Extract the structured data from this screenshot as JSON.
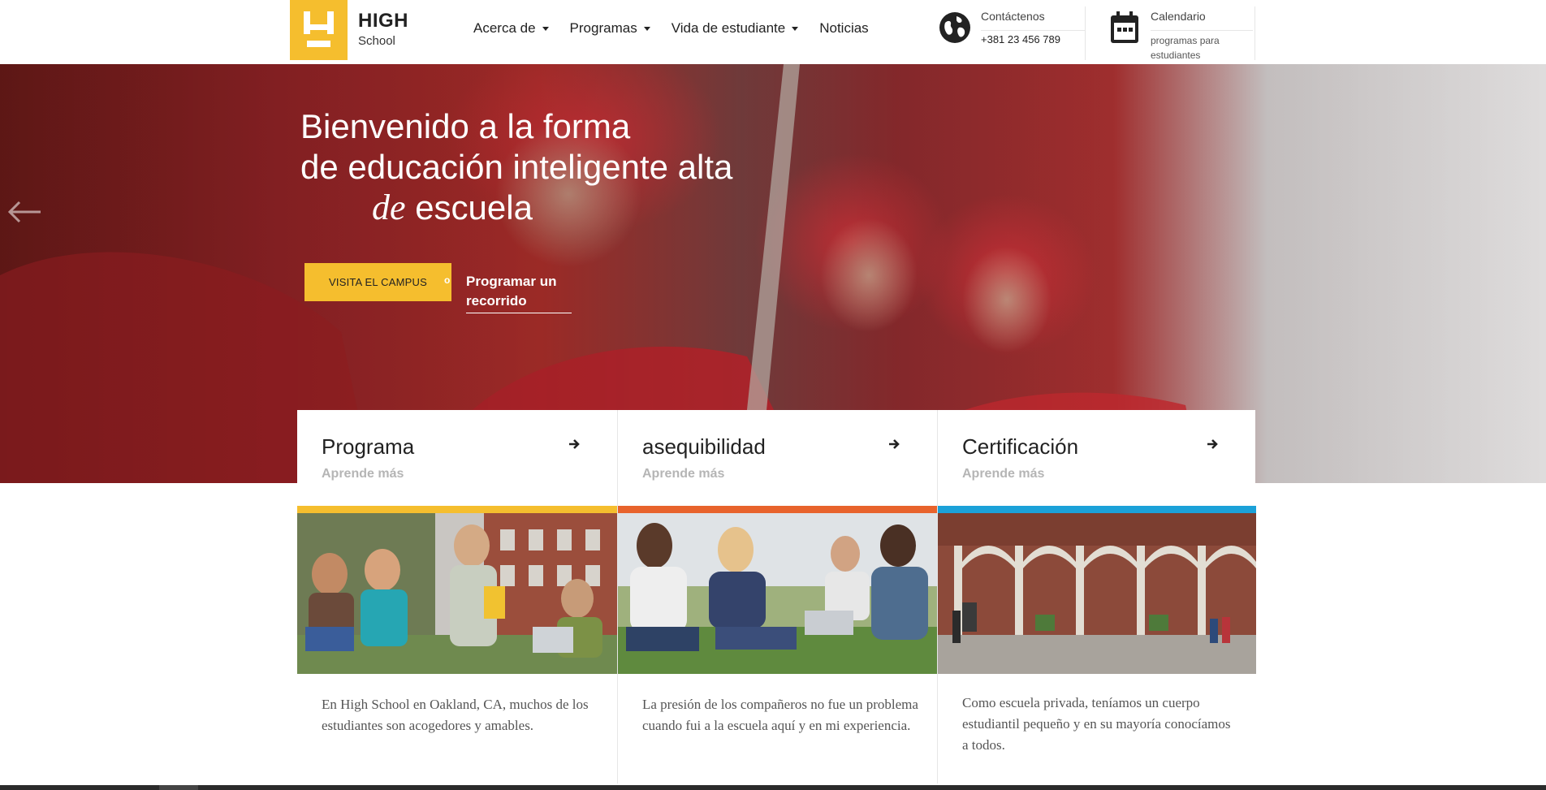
{
  "header": {
    "logo": {
      "title": "HIGH",
      "subtitle": "School",
      "accent": "#f5be2e"
    },
    "nav": [
      {
        "label": "Acerca de",
        "dropdown": true
      },
      {
        "label": "Programas",
        "dropdown": true
      },
      {
        "label": "Vida de estudiante",
        "dropdown": true
      },
      {
        "label": "Noticias",
        "dropdown": false
      }
    ],
    "contact": {
      "icon": "globe-icon",
      "label": "Contáctenos",
      "value": "+381 23 456 789"
    },
    "calendar": {
      "icon": "calendar-icon",
      "label": "Calendario",
      "value": "programas para estudiantes"
    }
  },
  "hero": {
    "title_line1": "Bienvenido a la forma",
    "title_line2": "de educación inteligente alta",
    "title_em": "de",
    "title_line3": "escuela",
    "cta_primary": "VISITA EL CAMPUS",
    "cta_or": "o",
    "cta_secondary": "Programar un recorrido",
    "prev_icon": "arrow-left-icon"
  },
  "cards": [
    {
      "title": "Programa",
      "link": "Aprende más",
      "color": "#f5be2e",
      "text": "En High School en Oakland, CA, muchos de los estudiantes son acogedores y amables."
    },
    {
      "title": "asequibilidad",
      "link": "Aprende más",
      "color": "#e8632c",
      "text": "La presión de los compañeros no fue un problema cuando fui a la escuela aquí y en mi experiencia."
    },
    {
      "title": "Certificación",
      "link": "Aprende más",
      "color": "#1ba1d8",
      "text": "Como escuela privada, teníamos un cuerpo estudiantil pequeño y en su mayoría conocíamos a todos."
    }
  ]
}
